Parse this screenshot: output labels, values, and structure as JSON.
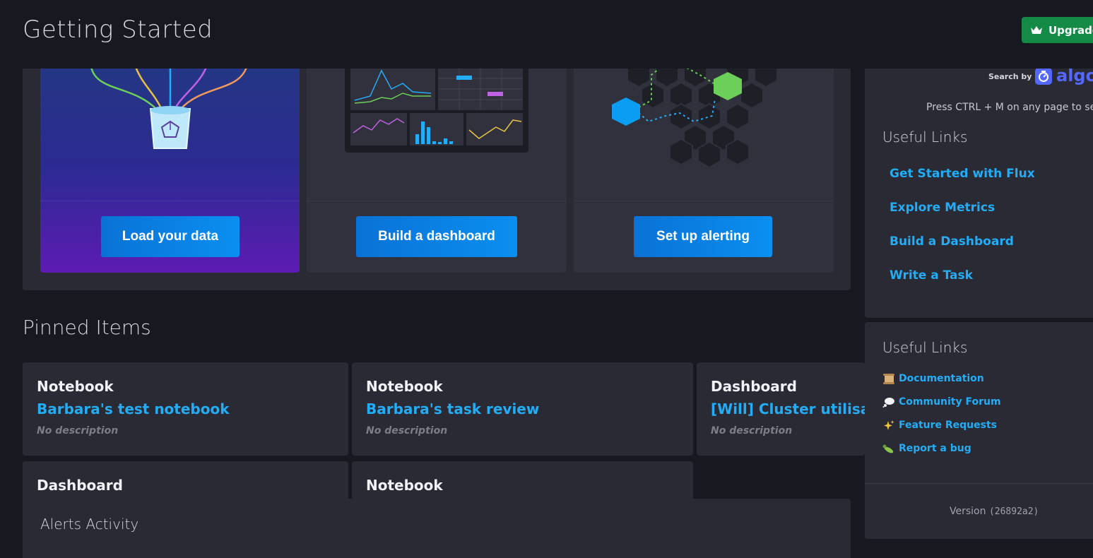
{
  "header": {
    "title": "Getting Started",
    "upgrade_label": "Upgrade"
  },
  "getting_started": {
    "cards": [
      {
        "id": "load",
        "button_label": "Load your data"
      },
      {
        "id": "dashboard",
        "button_label": "Build a dashboard"
      },
      {
        "id": "alerting",
        "button_label": "Set up alerting"
      }
    ]
  },
  "pinned": {
    "title": "Pinned Items",
    "items": [
      {
        "type": "Notebook",
        "name": "Barbara's test notebook",
        "description": "No description"
      },
      {
        "type": "Notebook",
        "name": "Barbara's task review",
        "description": "No description"
      },
      {
        "type": "Dashboard",
        "name": "[Will] Cluster utilisatic",
        "description": "No description"
      },
      {
        "type": "Dashboard",
        "name": "",
        "description": ""
      },
      {
        "type": "Notebook",
        "name": "",
        "description": ""
      }
    ]
  },
  "alerts": {
    "title": "Alerts Activity"
  },
  "search": {
    "search_by": "Search by",
    "brand": "algoli",
    "hint": "Press CTRL + M on any page to sea"
  },
  "useful_links": {
    "title": "Useful Links",
    "links": [
      "Get Started with Flux",
      "Explore Metrics",
      "Build a Dashboard",
      "Write a Task"
    ]
  },
  "resources": {
    "title": "Useful Links",
    "links": [
      {
        "label": "Documentation",
        "icon": "scroll-icon"
      },
      {
        "label": "Community Forum",
        "icon": "thought-bubble-icon"
      },
      {
        "label": "Feature Requests",
        "icon": "sparkles-icon"
      },
      {
        "label": "Report a bug",
        "icon": "bug-icon"
      }
    ]
  },
  "version": {
    "label": "Version",
    "hash": "(26892a2)"
  },
  "colors": {
    "accent_blue": "#22adf6",
    "button_blue": "#0a8ff0",
    "upgrade_green": "#138a46",
    "panel": "#2a2a35",
    "background": "#181820",
    "algolia": "#5468ff"
  }
}
